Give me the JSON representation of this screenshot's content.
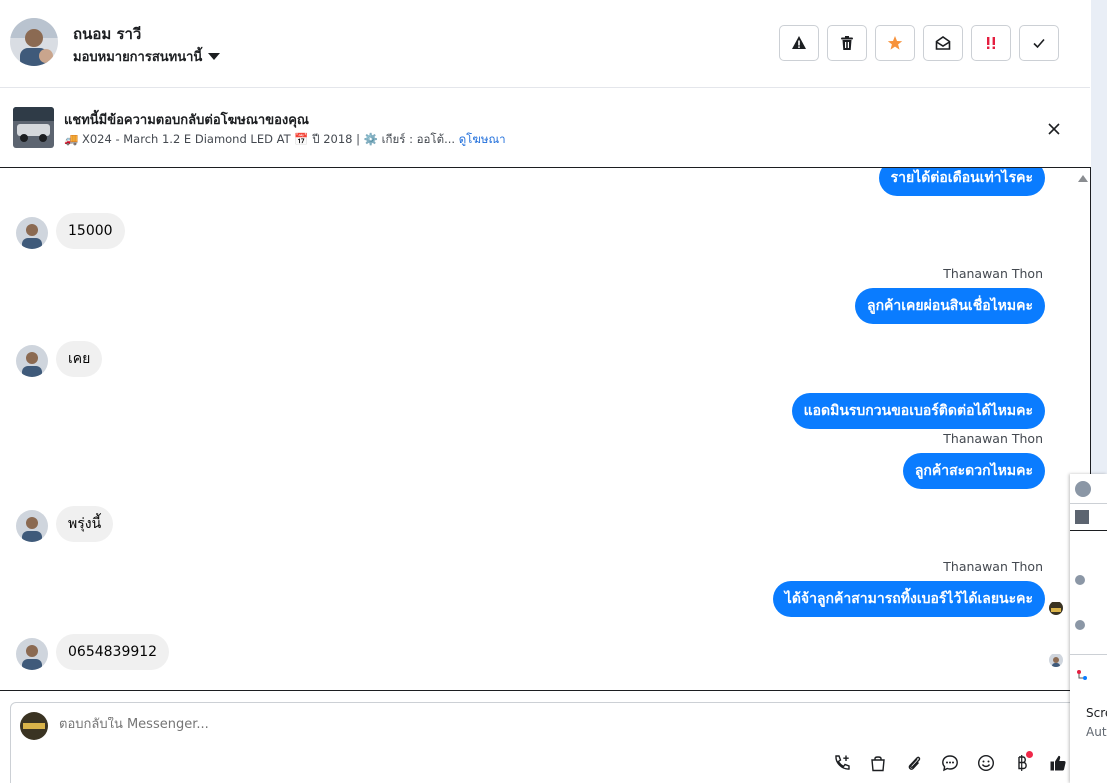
{
  "header": {
    "name": "ถนอม ราวี",
    "assign_label": "มอบหมายการสนทนานี้",
    "actions": [
      {
        "icon": "warning-icon"
      },
      {
        "icon": "trash-icon"
      },
      {
        "icon": "star-icon"
      },
      {
        "icon": "mark-unread-icon"
      },
      {
        "icon": "priority-icon"
      },
      {
        "icon": "check-icon"
      }
    ]
  },
  "banner": {
    "title": "แชทนี้มีข้อความตอบกลับต่อโฆษณาของคุณ",
    "subtitle": "🚚 X024 - March 1.2 E Diamond LED AT 📅 ปี 2018 | ⚙️ เกียร์ : ออโต้...",
    "link": "ดูโฆษณา"
  },
  "messages": [
    {
      "dir": "out",
      "text": "รายได้ต่อเดือนเท่าไรคะ"
    },
    {
      "dir": "in",
      "text": "15000"
    },
    {
      "dir": "out",
      "sender": "Thanawan Thon",
      "text": "ลูกค้าเคยผ่อนสินเชื่อไหมคะ"
    },
    {
      "dir": "in",
      "text": "เคย"
    },
    {
      "dir": "out",
      "text": "แอดมินรบกวนขอเบอร์ติดต่อได้ไหมคะ"
    },
    {
      "dir": "out",
      "sender": "Thanawan Thon",
      "text": "ลูกค้าสะดวกไหมคะ"
    },
    {
      "dir": "in",
      "text": "พรุ่งนี้"
    },
    {
      "dir": "out",
      "sender": "Thanawan Thon",
      "text": "ได้จ้าลูกค้าสามารถทิ้งเบอร์ไว้ได้เลยนะคะ"
    },
    {
      "dir": "in",
      "text": "0654839912"
    }
  ],
  "composer": {
    "placeholder": "ตอบกลับใน Messenger...",
    "tools": [
      "call-add-icon",
      "shopping-bag-icon",
      "attachment-icon",
      "chat-bubble-icon",
      "emoji-icon",
      "baht-icon",
      "thumbs-up-icon"
    ]
  },
  "mini_panel": {
    "text1": "Scre",
    "text2": "Aut"
  },
  "colors": {
    "accent": "#0a7cff",
    "star": "#f7923b",
    "priority": "#e41e3f"
  }
}
